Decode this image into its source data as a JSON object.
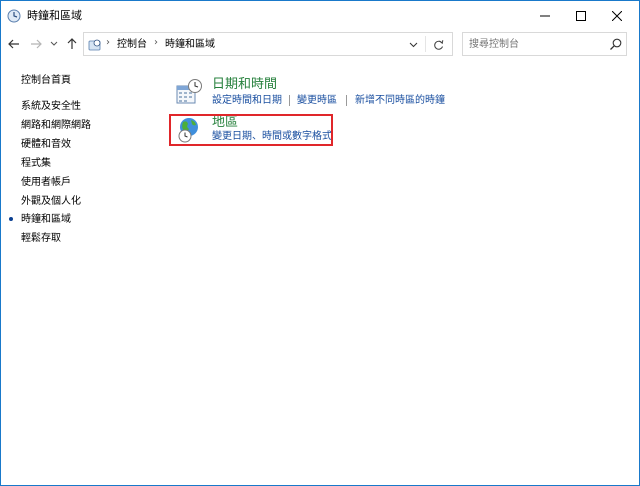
{
  "window": {
    "title": "時鐘和區域"
  },
  "address_bar": {
    "crumbs": [
      "控制台",
      "時鐘和區域"
    ]
  },
  "search": {
    "placeholder": "搜尋控制台"
  },
  "sidebar": {
    "items": [
      {
        "label": "控制台首頁"
      },
      {
        "label": "系統及安全性"
      },
      {
        "label": "網路和網際網路"
      },
      {
        "label": "硬體和音效"
      },
      {
        "label": "程式集"
      },
      {
        "label": "使用者帳戶"
      },
      {
        "label": "外觀及個人化"
      },
      {
        "label": "時鐘和區域",
        "current": true
      },
      {
        "label": "輕鬆存取"
      }
    ]
  },
  "categories": [
    {
      "title": "日期和時間",
      "icon": "calendar-clock-icon",
      "links": [
        "設定時間和日期",
        "變更時區",
        "新增不同時區的時鐘"
      ]
    },
    {
      "title": "地區",
      "icon": "globe-clock-icon",
      "links": [
        "變更日期、時間或數字格式"
      ],
      "highlighted": true
    }
  ],
  "colors": {
    "accent_link": "#1a4fa0",
    "category_title": "#26803c",
    "highlight_border": "#e0262a",
    "window_border": "#1979ca"
  }
}
